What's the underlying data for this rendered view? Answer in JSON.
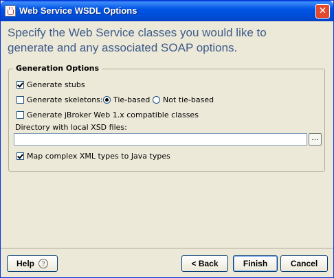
{
  "window": {
    "title": "Web Service WSDL Options"
  },
  "header": {
    "text": "Specify the Web Service classes you would like to generate and any associated SOAP options."
  },
  "group": {
    "legend": "Generation Options",
    "generate_stubs": {
      "label": "Generate stubs",
      "checked": true
    },
    "generate_skeletons": {
      "label": "Generate skeletons:",
      "checked": false
    },
    "tie_based": {
      "label": "Tie-based",
      "selected": true
    },
    "not_tie_based": {
      "label": "Not tie-based",
      "selected": false
    },
    "jbroker": {
      "label": "Generate jBroker Web 1.x compatible classes",
      "checked": false
    },
    "xsd_dir": {
      "label": "Directory with local XSD files:",
      "value": "",
      "browse_label": "..."
    },
    "map_complex": {
      "label": "Map complex XML types to Java types",
      "checked": true
    }
  },
  "buttons": {
    "help": "Help",
    "back": "< Back",
    "finish": "Finish",
    "cancel": "Cancel"
  },
  "colors": {
    "titlebar": "#0055e5",
    "header_text": "#3d5a8a",
    "background": "#ece9d8"
  }
}
